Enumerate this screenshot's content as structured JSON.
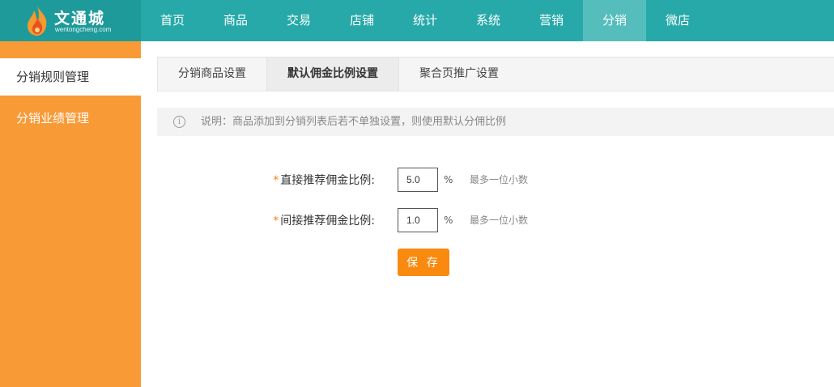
{
  "brand": {
    "title": "文通城",
    "subtitle": "wentongcheng.com",
    "logo_icon": "flame-logo-icon"
  },
  "nav": {
    "items": [
      {
        "label": "首页"
      },
      {
        "label": "商品"
      },
      {
        "label": "交易"
      },
      {
        "label": "店铺"
      },
      {
        "label": "统计"
      },
      {
        "label": "系统"
      },
      {
        "label": "营销"
      },
      {
        "label": "分销",
        "active": true
      },
      {
        "label": "微店"
      }
    ]
  },
  "sidebar": {
    "items": [
      {
        "label": "分销规则管理",
        "active": true
      },
      {
        "label": "分销业绩管理"
      }
    ]
  },
  "tabs": [
    {
      "label": "分销商品设置"
    },
    {
      "label": "默认佣金比例设置",
      "active": true
    },
    {
      "label": "聚合页推广设置"
    }
  ],
  "notice": {
    "icon": "info-icon",
    "text": "说明：商品添加到分销列表后若不单独设置，则使用默认分佣比例"
  },
  "form": {
    "required_mark": "*",
    "direct": {
      "label": "直接推荐佣金比例:",
      "value": "5.0",
      "unit": "%",
      "hint": "最多一位小数"
    },
    "indirect": {
      "label": "间接推荐佣金比例:",
      "value": "1.0",
      "unit": "%",
      "hint": "最多一位小数"
    },
    "save_label": "保 存"
  },
  "colors": {
    "topbar": "#27a9a9",
    "sidebar": "#f89a36",
    "save_button": "#f98a0f",
    "required": "#f5811f"
  }
}
